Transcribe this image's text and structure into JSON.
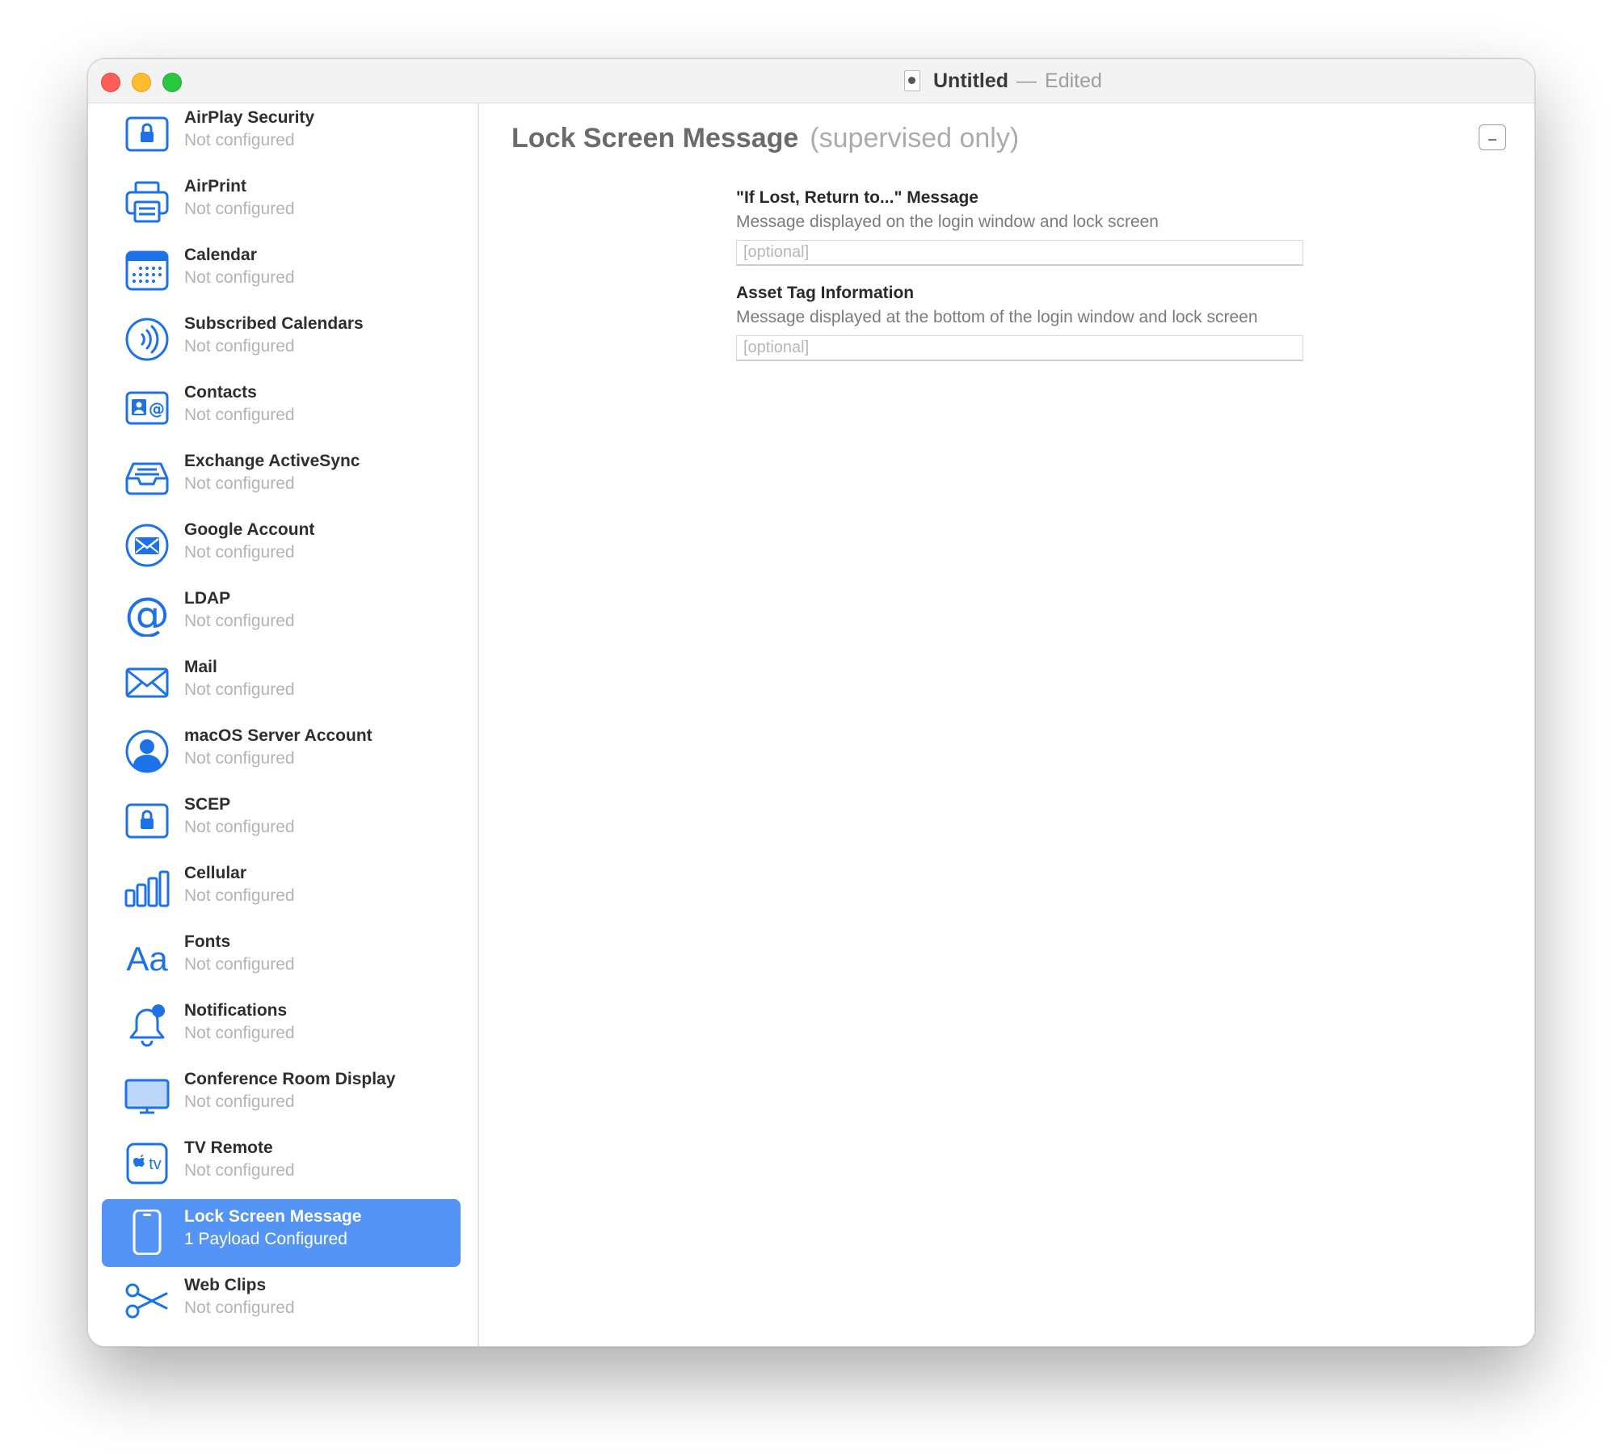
{
  "window": {
    "title": "Untitled",
    "separator": "—",
    "status": "Edited"
  },
  "sidebar": {
    "items": [
      {
        "title": "AirPlay Security",
        "subtitle": "Not configured",
        "icon": "lock-icon",
        "selected": false
      },
      {
        "title": "AirPrint",
        "subtitle": "Not configured",
        "icon": "printer-icon",
        "selected": false
      },
      {
        "title": "Calendar",
        "subtitle": "Not configured",
        "icon": "calendar-icon",
        "selected": false
      },
      {
        "title": "Subscribed Calendars",
        "subtitle": "Not configured",
        "icon": "broadcast-icon",
        "selected": false
      },
      {
        "title": "Contacts",
        "subtitle": "Not configured",
        "icon": "contact-card-icon",
        "selected": false
      },
      {
        "title": "Exchange ActiveSync",
        "subtitle": "Not configured",
        "icon": "inbox-tray-icon",
        "selected": false
      },
      {
        "title": "Google Account",
        "subtitle": "Not configured",
        "icon": "envelope-circle-icon",
        "selected": false
      },
      {
        "title": "LDAP",
        "subtitle": "Not configured",
        "icon": "at-sign-icon",
        "selected": false
      },
      {
        "title": "Mail",
        "subtitle": "Not configured",
        "icon": "envelope-icon",
        "selected": false
      },
      {
        "title": "macOS Server Account",
        "subtitle": "Not configured",
        "icon": "person-circle-icon",
        "selected": false
      },
      {
        "title": "SCEP",
        "subtitle": "Not configured",
        "icon": "lock-icon",
        "selected": false
      },
      {
        "title": "Cellular",
        "subtitle": "Not configured",
        "icon": "signal-bars-icon",
        "selected": false
      },
      {
        "title": "Fonts",
        "subtitle": "Not configured",
        "icon": "font-icon",
        "selected": false
      },
      {
        "title": "Notifications",
        "subtitle": "Not configured",
        "icon": "bell-icon",
        "selected": false
      },
      {
        "title": "Conference Room Display",
        "subtitle": "Not configured",
        "icon": "display-icon",
        "selected": false
      },
      {
        "title": "TV Remote",
        "subtitle": "Not configured",
        "icon": "apple-tv-icon",
        "selected": false
      },
      {
        "title": "Lock Screen Message",
        "subtitle": "1 Payload Configured",
        "icon": "iphone-icon",
        "selected": true
      },
      {
        "title": "Web Clips",
        "subtitle": "Not configured",
        "icon": "scissors-icon",
        "selected": false
      }
    ]
  },
  "main": {
    "title": "Lock Screen Message",
    "subtitle": "(supervised only)",
    "fields": [
      {
        "label": "\"If Lost, Return to...\" Message",
        "description": "Message displayed on the login window and lock screen",
        "value": "",
        "placeholder": "[optional]"
      },
      {
        "label": "Asset Tag Information",
        "description": "Message displayed at the bottom of the login window and lock screen",
        "value": "",
        "placeholder": "[optional]"
      }
    ]
  },
  "colors": {
    "accent": "#1d72e8",
    "selection": "#5394f4"
  }
}
